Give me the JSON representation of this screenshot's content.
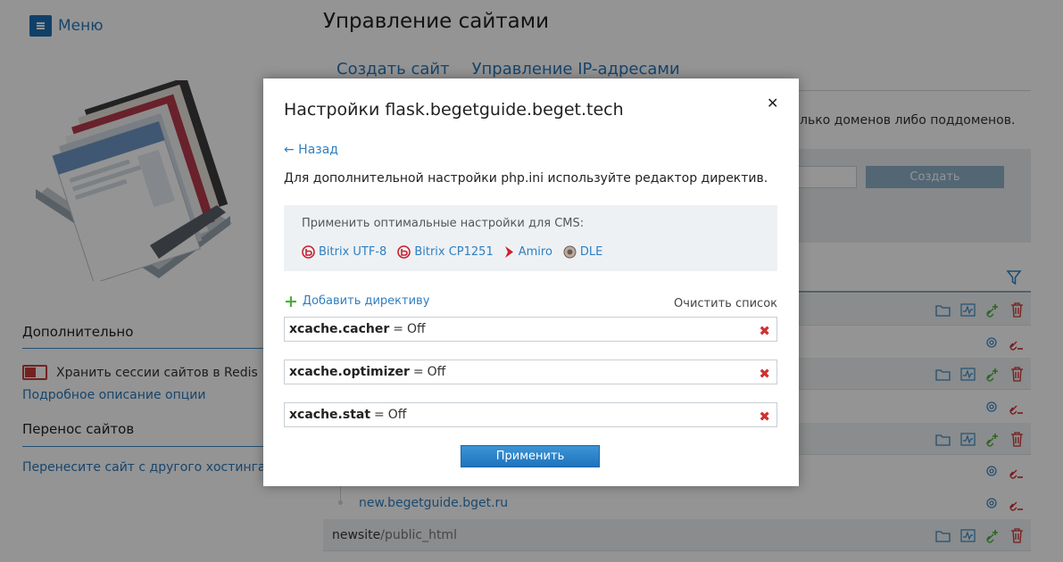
{
  "header": {
    "menu_label": "Меню",
    "page_title": "Управление сайтами"
  },
  "tabs": [
    {
      "label": "Создать сайт"
    },
    {
      "label": "Управление IP-адресами"
    }
  ],
  "info_text": "лько доменов либо поддоменов.",
  "create_button": "Создать",
  "sidebar": {
    "additional_heading": "Дополнительно",
    "redis_label": "Хранить сессии сайтов в Redis",
    "redis_details_link": "Подробное описание опции",
    "transfer_heading": "Перенос сайтов",
    "transfer_link": "Перенесите сайт с другого хостинга"
  },
  "site_list": {
    "subdomain": "new.begetguide.bget.ru",
    "last_site": {
      "name": "newsite",
      "path": "/public_html"
    }
  },
  "modal": {
    "title": "Настройки flask.begetguide.beget.tech",
    "back_label": "← Назад",
    "description": "Для дополнительной настройки php.ini используйте редактор директив.",
    "cms_label": "Применить оптимальные настройки для CMS:",
    "cms_options": [
      {
        "label": "Bitrix UTF-8",
        "icon": "bitrix-icon"
      },
      {
        "label": "Bitrix CP1251",
        "icon": "bitrix-icon"
      },
      {
        "label": "Amiro",
        "icon": "amiro-icon"
      },
      {
        "label": "DLE",
        "icon": "dle-icon"
      }
    ],
    "add_directive_label": "Добавить директиву",
    "clear_list_label": "Очистить список",
    "directives": [
      {
        "name": "xcache.cacher",
        "eq": "=",
        "value": "Off"
      },
      {
        "name": "xcache.optimizer",
        "eq": "=",
        "value": "Off"
      },
      {
        "name": "xcache.stat",
        "eq": "=",
        "value": "Off"
      }
    ],
    "apply_label": "Применить"
  },
  "colors": {
    "accent": "#2f7fc1",
    "apply_button": "#2a82c9",
    "delete": "#d03030",
    "add": "#4caf3a"
  }
}
